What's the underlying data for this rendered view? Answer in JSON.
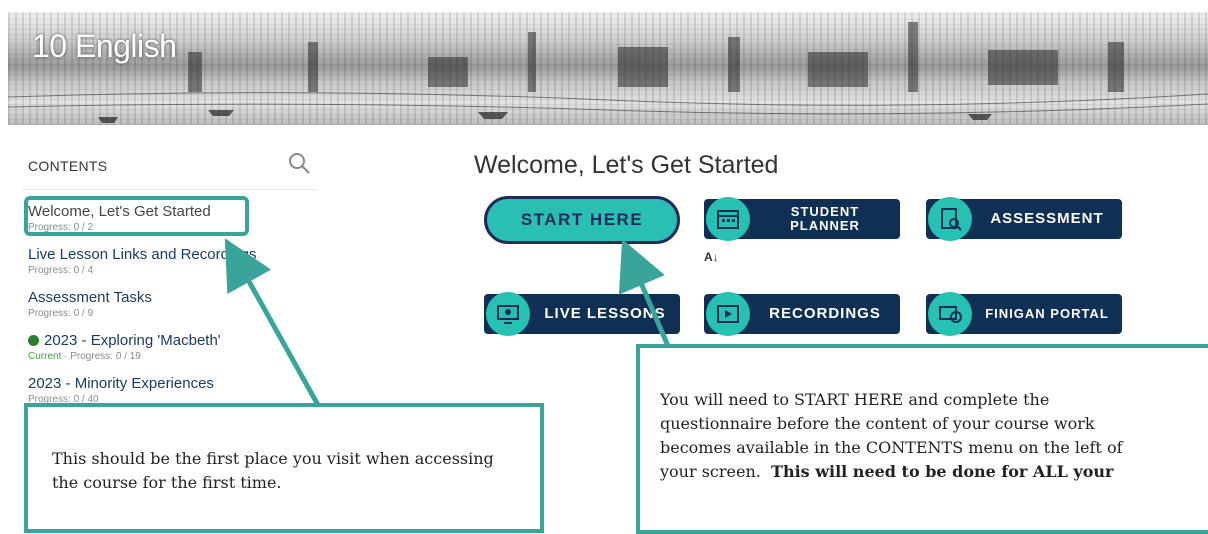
{
  "banner": {
    "title": "10 English"
  },
  "sidebar": {
    "heading": "CONTENTS",
    "items": [
      {
        "title": "Welcome, Let's Get Started",
        "progress": "Progress: 0 / 2"
      },
      {
        "title": "Live Lesson Links and Recordings",
        "progress": "Progress: 0 / 4"
      },
      {
        "title": "Assessment Tasks",
        "progress": "Progress: 0 / 9"
      },
      {
        "title": "2023 - Exploring 'Macbeth'",
        "status": "Current",
        "progress": "Progress: 0 / 19"
      },
      {
        "title": "2023 - Minority Experiences",
        "progress": "Progress: 0 / 40"
      }
    ]
  },
  "main": {
    "title": "Welcome, Let's Get Started",
    "start_label": "START HERE",
    "tiles": {
      "planner_line1": "STUDENT",
      "planner_line2": "PLANNER",
      "assessment": "ASSESSMENT",
      "live": "LIVE LESSONS",
      "recordings": "RECORDINGS",
      "finigan": "FINIGAN PORTAL"
    }
  },
  "callouts": {
    "left_text": "This should be the first place you visit when accessing the course for the first time.",
    "right_line1": "You will need to START HERE and complete the",
    "right_line2": "questionnaire before the content of your course work",
    "right_line3": "becomes available in the CONTENTS menu on the left of",
    "right_line4_plain": "your screen.",
    "right_line4_bold": "This will need to be done for ALL your"
  },
  "colors": {
    "accent": "#3aa49a",
    "tile": "#0f2f54",
    "teal": "#29bfb2",
    "navy": "#1f2a5c"
  }
}
